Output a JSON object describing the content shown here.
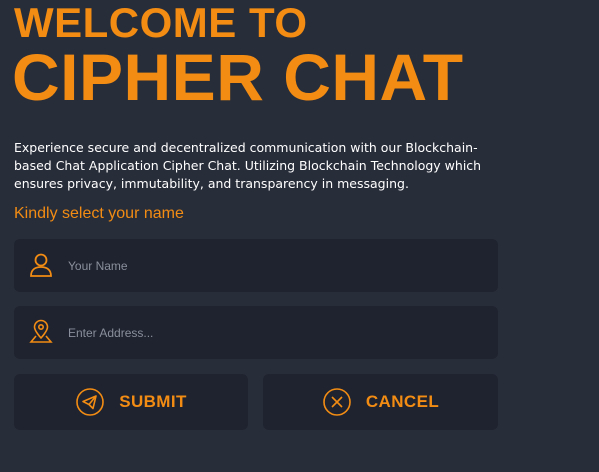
{
  "header": {
    "title_line1": "WELCOME TO",
    "title_line2": "CIPHER CHAT"
  },
  "description": "Experience secure and decentralized communication with our Blockchain-based Chat Application Cipher Chat. Utilizing Blockchain Technology which ensures privacy, immutability, and transparency in messaging.",
  "prompt": "Kindly select your name",
  "form": {
    "name_field": {
      "value": "",
      "placeholder": "Your Name",
      "icon": "user-icon"
    },
    "address_field": {
      "value": "",
      "placeholder": "Enter Address...",
      "icon": "location-pin-icon"
    }
  },
  "buttons": {
    "submit": {
      "label": "SUBMIT",
      "icon": "send-icon"
    },
    "cancel": {
      "label": "CANCEL",
      "icon": "close-circle-icon"
    }
  },
  "colors": {
    "background": "#282d3a",
    "panel": "#1f2330",
    "accent": "#f28c13",
    "text": "#ffffff",
    "placeholder": "#8a8f9c"
  }
}
